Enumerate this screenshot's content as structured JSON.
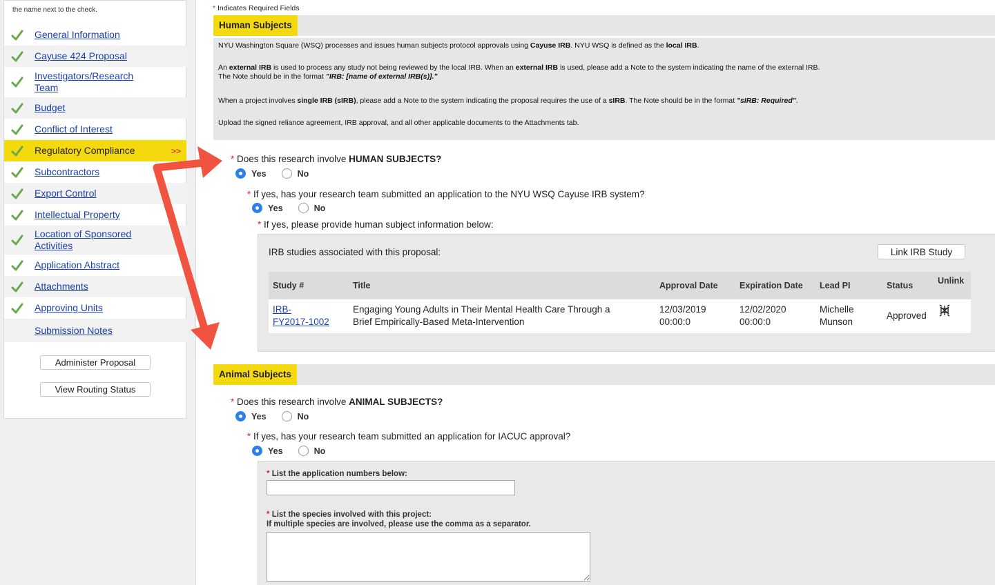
{
  "sidebar": {
    "hint": "the name next to the check.",
    "items": [
      {
        "label": "General Information"
      },
      {
        "label": "Cayuse 424 Proposal"
      },
      {
        "label": "Investigators/Research Team"
      },
      {
        "label": "Budget"
      },
      {
        "label": "Conflict of Interest"
      },
      {
        "label": "Regulatory Compliance",
        "active_marker": ">>"
      },
      {
        "label": "Subcontractors"
      },
      {
        "label": "Export Control"
      },
      {
        "label": "Intellectual Property"
      },
      {
        "label": "Location of Sponsored Activities"
      },
      {
        "label": "Application Abstract"
      },
      {
        "label": "Attachments"
      },
      {
        "label": "Approving Units"
      },
      {
        "label": "Submission Notes"
      }
    ],
    "buttons": {
      "administer": "Administer Proposal",
      "routing": "View Routing Status"
    }
  },
  "main": {
    "required_note": "Indicates Required Fields",
    "required_marker": "*",
    "human": {
      "title": "Human Subjects",
      "info": {
        "p1_a": "NYU Washington Square (WSQ) processes and issues human subjects protocol approvals using ",
        "p1_b": "Cayuse IRB",
        "p1_c": ". NYU WSQ is defined as the ",
        "p1_d": "local IRB",
        "p1_e": ".",
        "p2_a": "An ",
        "p2_b": "external IRB",
        "p2_c": " is used to process any study not being reviewed by the local IRB. When an ",
        "p2_d": "external IRB",
        "p2_e": " is used, please add a Note to the system indicating the name of the external IRB.",
        "p2_f": "The Note should be in the format ",
        "p2_g": "\"IRB: [name of external IRB(s)].\"",
        "p3_a": "When a project involves ",
        "p3_b": "single IRB (sIRB)",
        "p3_c": ", please add a Note to the system indicating the proposal requires the use of a ",
        "p3_d": "sIRB",
        "p3_e": ". The Note should be in the format ",
        "p3_f": "\"sIRB: Required\"",
        "p3_g": ".",
        "p4": "Upload the signed reliance agreement, IRB approval, and all other applicable documents to the Attachments tab."
      },
      "q1_a": "Does this research involve ",
      "q1_b": "HUMAN SUBJECTS?",
      "q2": "If yes, has your research team submitted an application to the NYU WSQ Cayuse IRB system?",
      "q3": "If yes, please provide human subject information below:",
      "irb_caption": "IRB studies associated with this proposal:",
      "link_button": "Link IRB Study",
      "table": {
        "headers": [
          "Study #",
          "Title",
          "Approval Date",
          "Expiration Date",
          "Lead PI",
          "Status",
          "Unlink"
        ],
        "row": {
          "study_1": "IRB-",
          "study_2": "FY2017-1002",
          "title_1": "Engaging Young Adults in Their Mental Health Care Through a",
          "title_2": "Brief Empirically-Based Meta-Intervention",
          "approval_1": "12/03/2019",
          "approval_2": "00:00:0",
          "expiration_1": "12/02/2020",
          "expiration_2": "00:00:0",
          "pi_1": "Michelle",
          "pi_2": "Munson",
          "status": "Approved"
        }
      }
    },
    "animal": {
      "title": "Animal Subjects",
      "q1_a": "Does this research involve ",
      "q1_b": "ANIMAL SUBJECTS?",
      "q2": "If yes, has your research team submitted an application for IACUC approval?",
      "label_numbers": "List the application numbers below:",
      "label_species_1": "List the species involved with this project:",
      "label_species_2": "If multiple species are involved, please use the comma as a separator.",
      "numbers_value": "",
      "species_value": ""
    },
    "radio": {
      "yes": "Yes",
      "no": "No"
    }
  },
  "colors": {
    "highlight": "#f5d90f",
    "link": "#1a3fb0",
    "annotation_arrow": "#f0533f",
    "check": "#6aa84f",
    "radio_selected": "#2f7fe8"
  },
  "icons": {
    "nav_status": "check-icon",
    "unlink": "unlink-icon"
  }
}
